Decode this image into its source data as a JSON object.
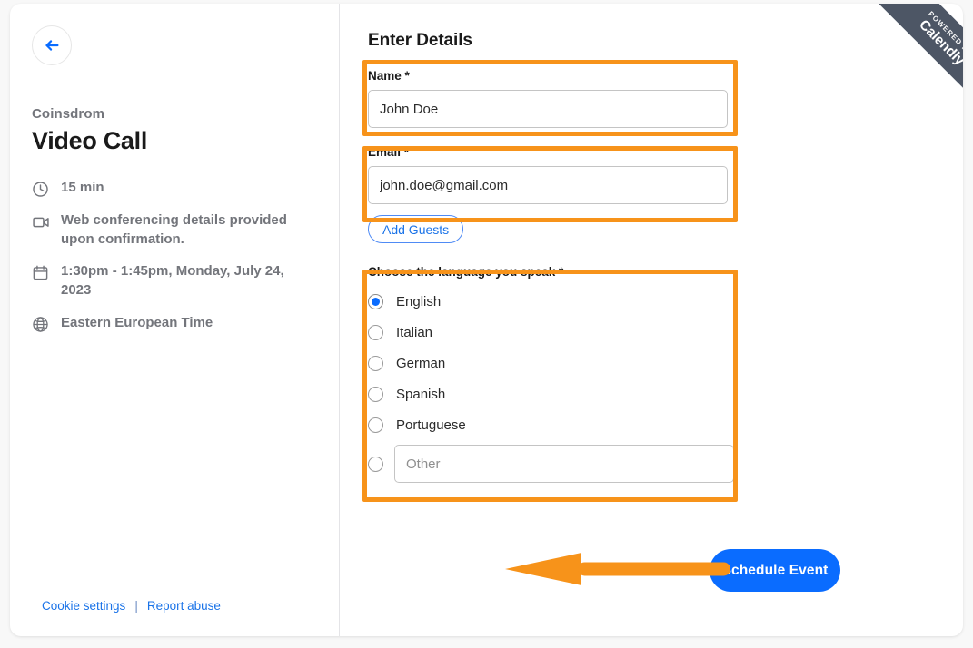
{
  "sidebar": {
    "back_button_icon": "arrow-left-icon",
    "organization": "Coinsdrom",
    "event_title": "Video Call",
    "details": [
      {
        "icon": "clock-icon",
        "text": "15 min"
      },
      {
        "icon": "video-camera-icon",
        "text": "Web conferencing details provided upon confirmation."
      },
      {
        "icon": "calendar-icon",
        "text": "1:30pm - 1:45pm, Monday, July 24, 2023"
      },
      {
        "icon": "globe-icon",
        "text": "Eastern European Time"
      }
    ],
    "footer": {
      "cookie_settings": "Cookie settings",
      "separator": "|",
      "report_abuse": "Report abuse"
    }
  },
  "form": {
    "title": "Enter Details",
    "name_field": {
      "label": "Name *",
      "value": "John Doe",
      "placeholder": ""
    },
    "email_field": {
      "label": "Email *",
      "value": "john.doe@gmail.com",
      "placeholder": ""
    },
    "add_guests_label": "Add Guests",
    "language_question": {
      "label": "Choose the language you speak *",
      "options": [
        {
          "label": "English",
          "selected": true
        },
        {
          "label": "Italian",
          "selected": false
        },
        {
          "label": "German",
          "selected": false
        },
        {
          "label": "Spanish",
          "selected": false
        },
        {
          "label": "Portuguese",
          "selected": false
        }
      ],
      "other_option": {
        "selected": false,
        "placeholder": "Other",
        "value": ""
      }
    },
    "submit_label": "Schedule Event"
  },
  "ribbon": {
    "powered_by": "POWERED BY",
    "brand": "Calendly"
  },
  "colors": {
    "accent_blue": "#0a6cff",
    "link_blue": "#1a73e8",
    "annotation_orange": "#f7931a",
    "ribbon_gray": "#4d5665",
    "muted_text": "#73757b"
  }
}
